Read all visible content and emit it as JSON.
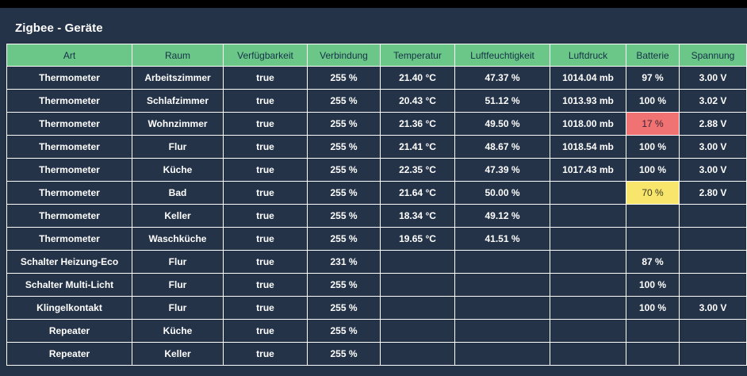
{
  "title": "Zigbee - Geräte",
  "colors": {
    "background": "#000000",
    "panel": "#243348",
    "header_bg": "#6bc787",
    "header_text": "#16324a",
    "grid_line": "#ffffff",
    "battery_low": "#f07272",
    "battery_warn": "#f7e66b"
  },
  "columns": [
    "Art",
    "Raum",
    "Verfügbarkeit",
    "Verbindung",
    "Temperatur",
    "Luftfeuchtigkeit",
    "Luftdruck",
    "Batterie",
    "Spannung"
  ],
  "rows": [
    [
      "Thermometer",
      "Arbeitszimmer",
      "true",
      "255 %",
      "21.40 °C",
      "47.37 %",
      "1014.04 mb",
      "97 %",
      "3.00 V"
    ],
    [
      "Thermometer",
      "Schlafzimmer",
      "true",
      "255 %",
      "20.43 °C",
      "51.12 %",
      "1013.93 mb",
      "100 %",
      "3.02 V"
    ],
    [
      "Thermometer",
      "Wohnzimmer",
      "true",
      "255 %",
      "21.36 °C",
      "49.50 %",
      "1018.00 mb",
      "17 %",
      "2.88 V"
    ],
    [
      "Thermometer",
      "Flur",
      "true",
      "255 %",
      "21.41 °C",
      "48.67 %",
      "1018.54 mb",
      "100 %",
      "3.00 V"
    ],
    [
      "Thermometer",
      "Küche",
      "true",
      "255 %",
      "22.35 °C",
      "47.39 %",
      "1017.43 mb",
      "100 %",
      "3.00 V"
    ],
    [
      "Thermometer",
      "Bad",
      "true",
      "255 %",
      "21.64 °C",
      "50.00 %",
      "",
      "70 %",
      "2.80 V"
    ],
    [
      "Thermometer",
      "Keller",
      "true",
      "255 %",
      "18.34 °C",
      "49.12 %",
      "",
      "",
      ""
    ],
    [
      "Thermometer",
      "Waschküche",
      "true",
      "255 %",
      "19.65 °C",
      "41.51 %",
      "",
      "",
      ""
    ],
    [
      "Schalter Heizung-Eco",
      "Flur",
      "true",
      "231 %",
      "",
      "",
      "",
      "87 %",
      ""
    ],
    [
      "Schalter Multi-Licht",
      "Flur",
      "true",
      "255 %",
      "",
      "",
      "",
      "100 %",
      ""
    ],
    [
      "Klingelkontakt",
      "Flur",
      "true",
      "255 %",
      "",
      "",
      "",
      "100 %",
      "3.00 V"
    ],
    [
      "Repeater",
      "Küche",
      "true",
      "255 %",
      "",
      "",
      "",
      "",
      ""
    ],
    [
      "Repeater",
      "Keller",
      "true",
      "255 %",
      "",
      "",
      "",
      "",
      ""
    ]
  ],
  "highlights": {
    "2": {
      "7": "cell-red"
    },
    "5": {
      "7": "cell-yellow"
    }
  }
}
